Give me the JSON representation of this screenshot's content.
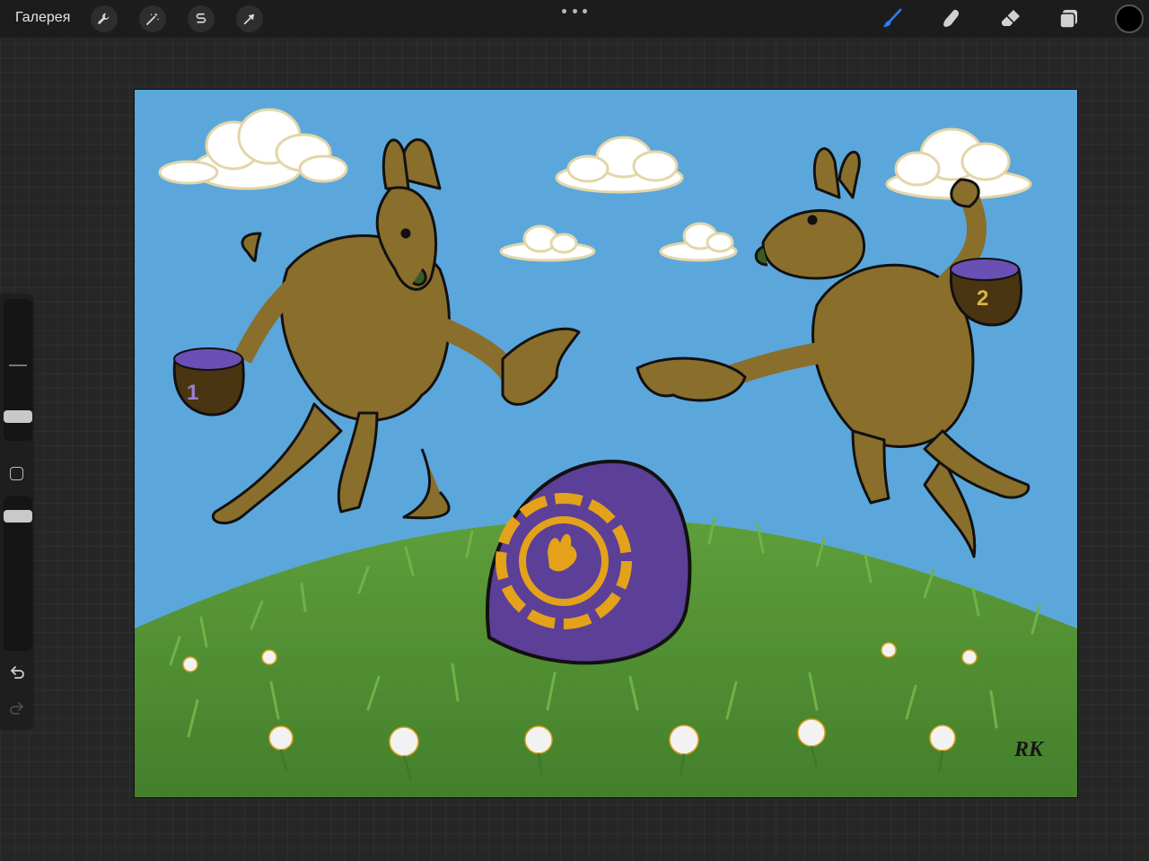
{
  "topbar": {
    "gallery_label": "Галерея",
    "left_tools": [
      {
        "name": "actions",
        "icon": "wrench-icon"
      },
      {
        "name": "adjustments",
        "icon": "magic-wand-icon"
      },
      {
        "name": "selection",
        "icon": "selection-s-icon"
      },
      {
        "name": "transform",
        "icon": "arrow-cursor-icon"
      }
    ],
    "more_icon": "ellipsis-icon",
    "right_tools": [
      {
        "name": "brush",
        "icon": "brush-icon",
        "active": true
      },
      {
        "name": "smudge",
        "icon": "smudge-finger-icon",
        "active": false
      },
      {
        "name": "eraser",
        "icon": "eraser-icon",
        "active": false
      },
      {
        "name": "layers",
        "icon": "layers-icon",
        "active": false
      }
    ],
    "current_color": "#000000"
  },
  "sidebar": {
    "size_slider_icon": "brush-size-slider",
    "opacity_slider_icon": "opacity-slider",
    "modify_icon": "square-modify-icon",
    "undo_icon": "undo-arrow-icon",
    "redo_icon": "redo-arrow-icon"
  },
  "artwork": {
    "description_colors": {
      "sky": "#5ba7dc",
      "grass": "#4f8f34",
      "egg": "#5c3f97",
      "egg_emblem": "#e3a21a",
      "kangaroo": "#8a6e2c"
    },
    "basket_left_number": "1",
    "basket_right_number": "2",
    "signature": "RK"
  },
  "colors": {
    "accent": "#2f7cf6",
    "toolbar_bg": "#1c1c1c"
  }
}
